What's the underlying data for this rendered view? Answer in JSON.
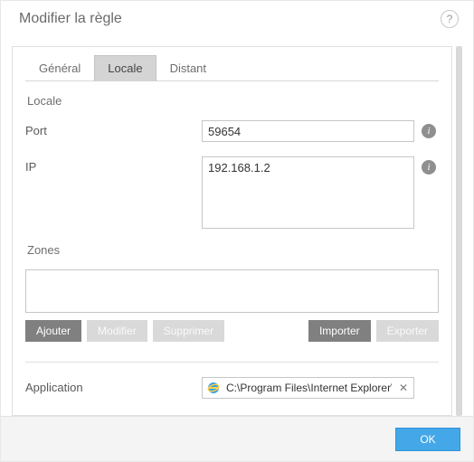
{
  "header": {
    "title": "Modifier la règle",
    "help_char": "?"
  },
  "tabs": {
    "general": "Général",
    "local": "Locale",
    "remote": "Distant",
    "active": "local"
  },
  "section": {
    "locale_label": "Locale",
    "port_label": "Port",
    "ip_label": "IP",
    "zones_label": "Zones",
    "application_label": "Application"
  },
  "fields": {
    "port_value": "59654",
    "ip_value": "192.168.1.2",
    "application_path": "C:\\Program Files\\Internet Explorer\\"
  },
  "buttons": {
    "add": "Ajouter",
    "edit": "Modifier",
    "delete": "Supprimer",
    "import": "Importer",
    "export": "Exporter",
    "ok": "OK"
  },
  "icons": {
    "info": "i",
    "clear": "✕",
    "app_icon": "ie-icon"
  }
}
